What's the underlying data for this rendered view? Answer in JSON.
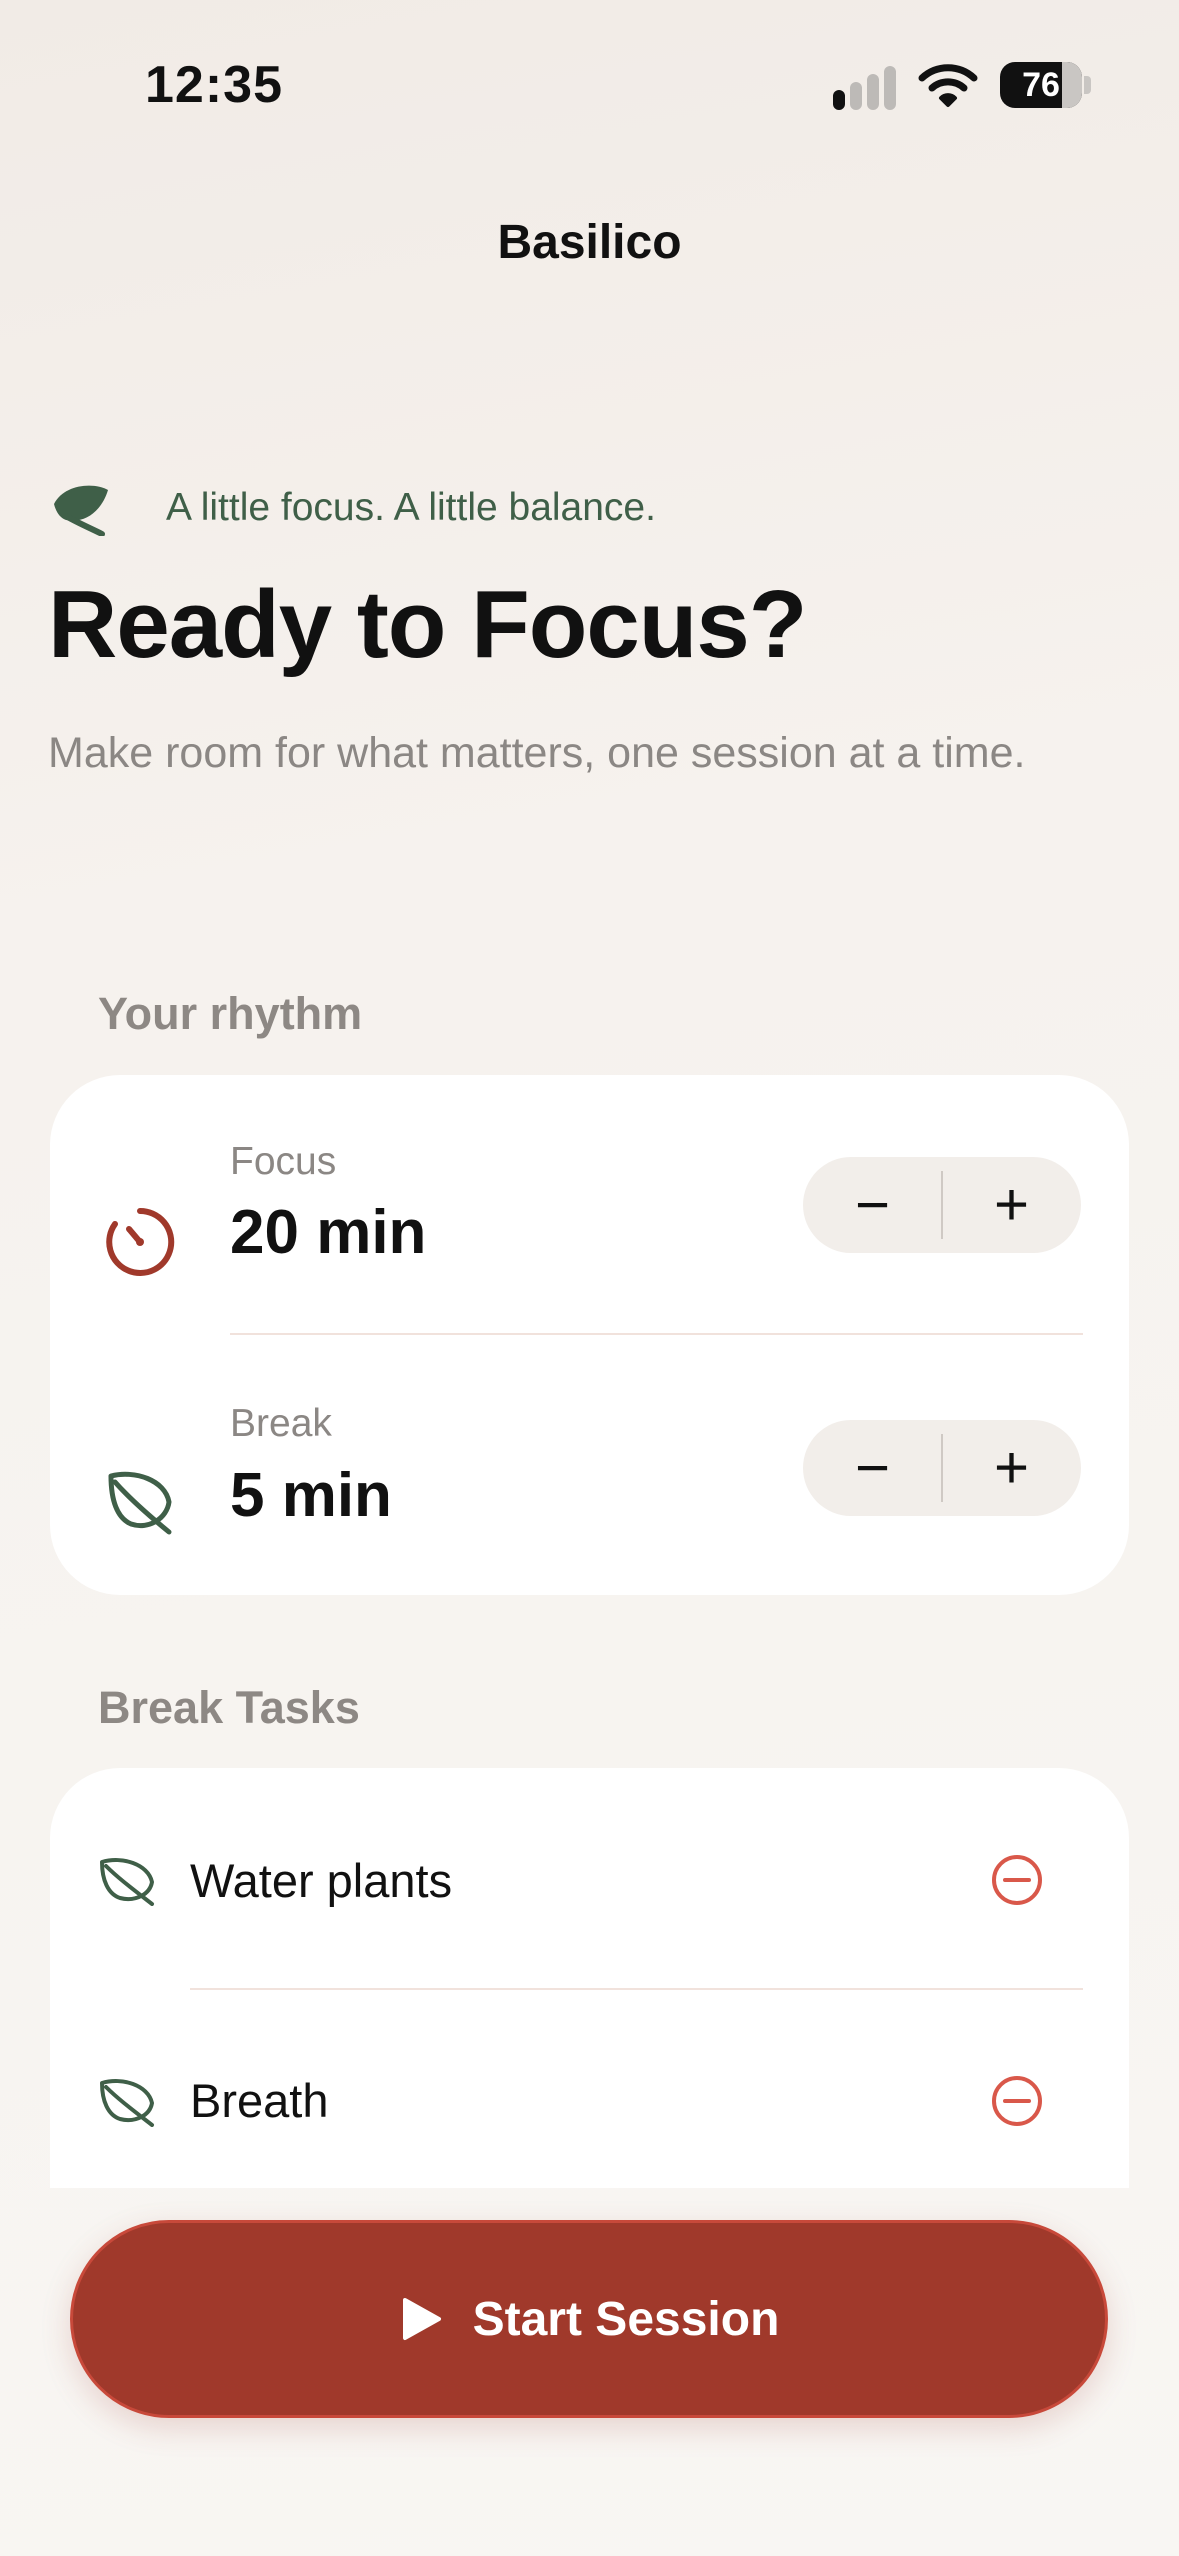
{
  "status_bar": {
    "time": "12:35",
    "battery": "76",
    "battery_level_percent": 76,
    "icons": [
      "cellular-signal-icon",
      "wifi-icon",
      "battery-icon"
    ]
  },
  "nav": {
    "title": "Basilico"
  },
  "hero": {
    "tagline": "A little focus. A little balance.",
    "headline": "Ready to Focus?",
    "subtitle": "Make room for what matters, one session at a time."
  },
  "rhythm": {
    "section_label": "Your rhythm",
    "focus": {
      "label": "Focus",
      "value": "20 min",
      "icon": "timer-icon",
      "minus": "−",
      "plus": "+"
    },
    "break": {
      "label": "Break",
      "value": "5 min",
      "icon": "leaf-icon",
      "minus": "−",
      "plus": "+"
    }
  },
  "break_tasks": {
    "section_label": "Break Tasks",
    "items": [
      {
        "label": "Water plants",
        "icon": "leaf-icon",
        "action_icon": "remove-icon"
      },
      {
        "label": "Breath",
        "icon": "leaf-icon",
        "action_icon": "remove-icon"
      }
    ]
  },
  "primary_action": {
    "label": "Start Session",
    "icon": "play-icon"
  },
  "colors": {
    "accent_red": "#a0392b",
    "leaf_green": "#3f5f48",
    "remove_red": "#d9584a",
    "muted_text": "#8b8784",
    "stepper_bg": "#f2eeea"
  }
}
